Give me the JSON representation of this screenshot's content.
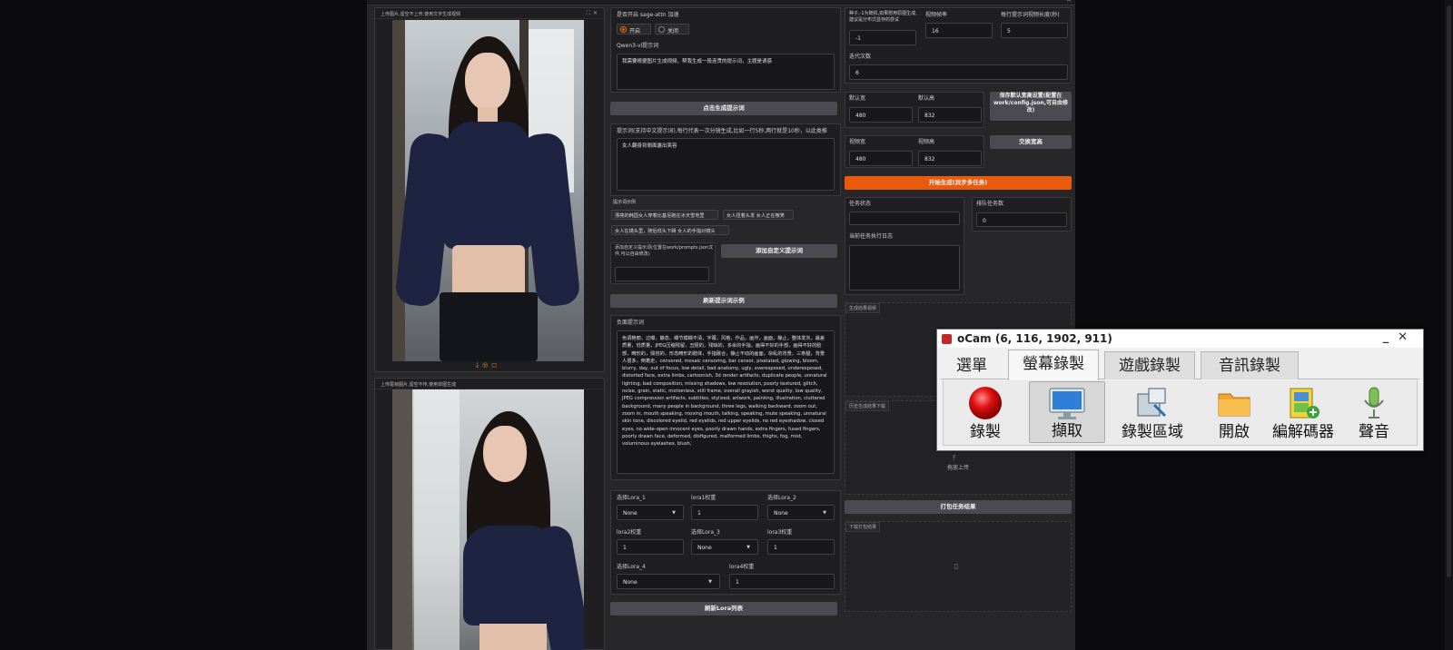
{
  "window": {
    "title": ""
  },
  "left_column": {
    "image1_label": "上传图片,留空不上传,使用文字生成视频",
    "image2_label": "上传尾帧图片,留空不传,使用单图生成"
  },
  "middle_column": {
    "sage_attn": {
      "label": "是否开启 sage-attn 加速",
      "on": "开启",
      "off": "关闭"
    },
    "qwen_label": "Qwen3-vl提示词",
    "qwen_text": "我需要根据图片生成视频，帮我生成一段连贯的提示词，主题是诱惑",
    "generate_prompt_button": "点击生成提示词",
    "prompt_label": "提示词(支持中文提示词),每行代表一次分镜生成,比如一行5秒,两行就是10秒，以此类推",
    "prompt_text": "女人翻身到侧面露出笑容",
    "examples_label": "提示词示例",
    "examples": [
      "漂亮的韩国女人穿着比基尼跑在冰天雪地里",
      "女人扭着头发 女人正在微笑",
      "女人在镜头里，随后低头下蹲 女人的手指对镜头"
    ],
    "custom_prompt_label": "添加自定义提示词(位置在work/prompts.json文件,可以自由修改)",
    "add_custom_button": "添加自定义提示词",
    "refresh_examples_button": "刷新提示词示例",
    "negative_label": "负面提示词",
    "negative_text": "色调艳丽，过曝，静态，细节模糊不清，字幕，风格，作品，画作，画面，静止，整体发灰，最差质量，低质量，JPEG压缩残留，丑陋的，残缺的，多余的手指，画得不好的手部，画得不好的脸部，畸形的，毁容的，形态畸形的肢体，手指融合，静止不动的画面，杂乱的背景，三条腿，背景人很多，倒着走，censored, mosaic censoring, bar censor, pixelated, glowing, bloom, blurry, day, out of focus, low detail, bad anatomy, ugly, overexposed, underexposed, distorted face, extra limbs, cartoonish, 3d render artifacts, duplicate people, unnatural lighting, bad composition, missing shadows, low resolution, poorly textured, glitch, noise, grain, static, motionless, still frame, overall grayish, worst quality, low quality, JPEG compression artifacts, subtitles, stylized, artwork, painting, illustration, cluttered background, many people in background, three legs, walking backward, zoom out, zoom in, mouth speaking, moving mouth, talking, speaking, mute speaking, unnatural skin tone, discolored eyelid, red eyelids, red upper eyelids, no red eyeshadow, closed eyes, no wide-open innocent eyes, poorly drawn hands, extra fingers, fused fingers, poorly drawn face, deformed, disfigured, malformed limbs, thighs, fog, mist, voluminous eyelashes, blush,",
    "lora": {
      "lora1_label": "选择Lora_1",
      "lora1_value": "None",
      "lora1_weight_label": "lora1权重",
      "lora1_weight": "1",
      "lora2_label": "选择Lora_2",
      "lora2_value": "None",
      "lora2_weight_label": "lora2权重",
      "lora2_weight": "1",
      "lora3_label": "选择Lora_3",
      "lora3_value": "None",
      "lora3_weight_label": "lora3权重",
      "lora3_weight": "1",
      "lora4_label": "选择Lora_4",
      "lora4_value": "None",
      "lora4_weight_label": "lora4权重",
      "lora4_weight": "1"
    },
    "refresh_lora_button": "刷新Lora列表"
  },
  "right_column": {
    "seed_label": "种子,-1为随机,如果想用原图生成,建议是分布式显存的尝试",
    "seed_value": "-1",
    "fps_label": "视频帧率",
    "fps_value": "16",
    "seconds_label": "每行提示词视频长度(秒)",
    "seconds_value": "5",
    "steps_label": "迭代次数",
    "steps_value": "6",
    "width_label": "默认宽",
    "width_value": "480",
    "height_label": "默认高",
    "height_value": "832",
    "save_default_button": "保存默认宽高设置(配置在work/config.json,可自由修改)",
    "video_width_label": "视频宽",
    "video_width_value": "480",
    "video_height_label": "视频高",
    "video_height_value": "832",
    "swap_button": "交换宽高",
    "start_button": "开始生成(异步多任务)",
    "task_status_label": "任务状态",
    "queue_label": "排队任务数",
    "queue_value": "0",
    "log_label": "当前任务执行日志",
    "result_label": "生成结果视频",
    "upload_label": "历史生成结果下载",
    "drop_text": "拖放上传",
    "pack_button": "打包任务结果",
    "download_label": "下载打包结果"
  },
  "ocam": {
    "title": "oCam (6, 116, 1902, 911)",
    "tabs": [
      "選單",
      "螢幕錄製",
      "遊戲錄製",
      "音訊錄製"
    ],
    "tools": [
      "錄製",
      "擷取",
      "錄製區域",
      "開啟",
      "編解碼器",
      "聲音"
    ]
  }
}
